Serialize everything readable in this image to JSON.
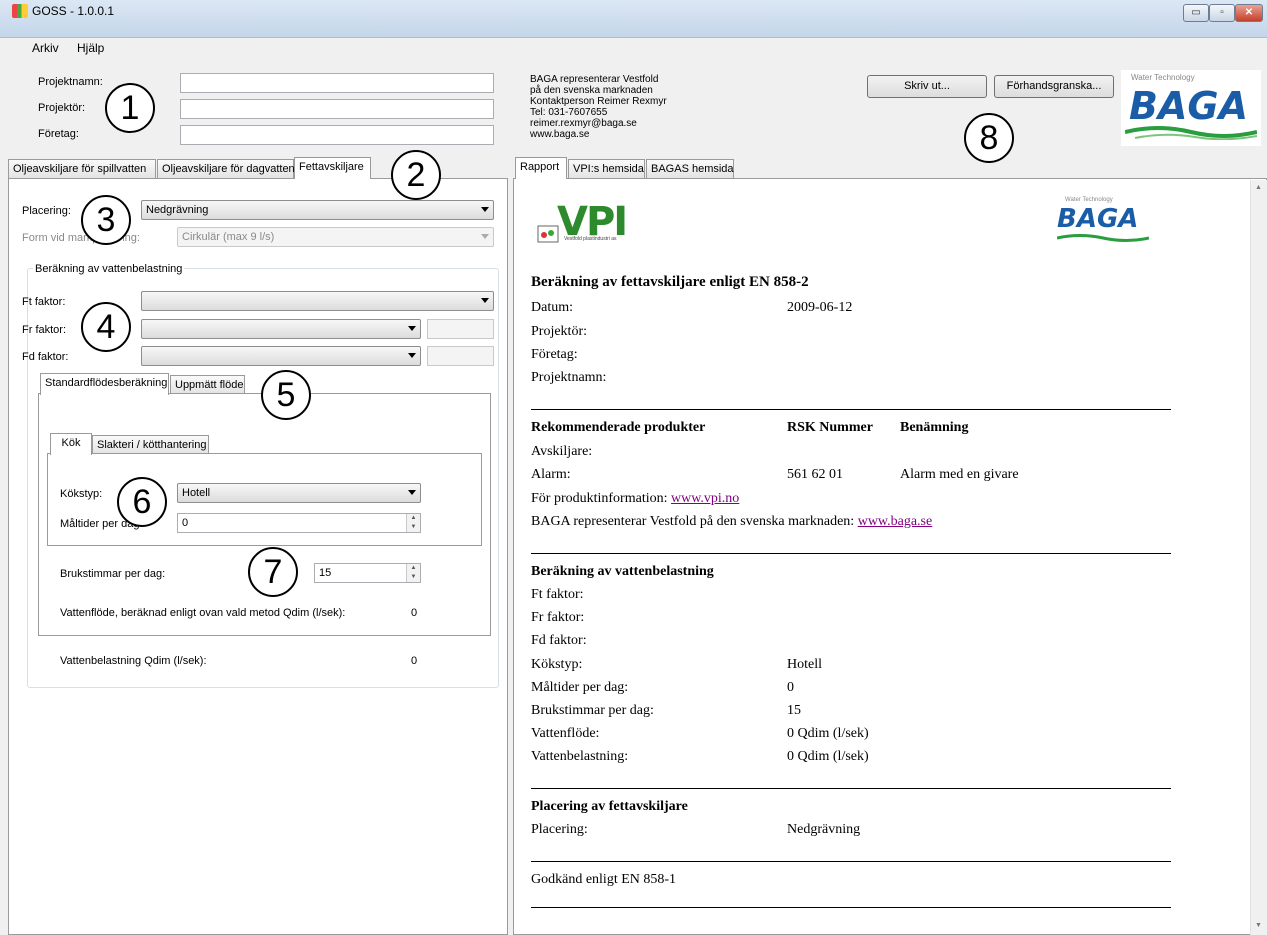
{
  "window": {
    "title": "GOSS - 1.0.0.1",
    "controls": {
      "minimize": "▭",
      "maximize": "▫",
      "close": "✕"
    }
  },
  "menu": [
    "Arkiv",
    "Hjälp"
  ],
  "project": {
    "name_label": "Projektnamn:",
    "designer_label": "Projektör:",
    "company_label": "Företag:",
    "name_value": "",
    "designer_value": "",
    "company_value": ""
  },
  "contact": {
    "lines": [
      "BAGA representerar Vestfold",
      "på den svenska marknaden",
      "Kontaktperson Reimer Rexmyr",
      "Tel: 031-7607655",
      "reimer.rexmyr@baga.se",
      "www.baga.se"
    ]
  },
  "buttons": {
    "print": "Skriv ut...",
    "preview": "Förhandsgranska..."
  },
  "logo": {
    "tagline": "Water Technology",
    "name": "BAGA",
    "vpi": "VPI",
    "vpi_sub": "Vestfold plastindustri as"
  },
  "left_tabs": [
    "Oljeavskiljare för spillvatten",
    "Oljeavskiljare för dagvatten",
    "Fettavskiljare"
  ],
  "form": {
    "placement_label": "Placering:",
    "placement_value": "Nedgrävning",
    "shape_label": "Form vid markplacering:",
    "shape_value": "Cirkulär (max 9 l/s)",
    "group_title": "Beräkning av vattenbelastning",
    "ft_label": "Ft faktor:",
    "fr_label": "Fr faktor:",
    "fd_label": "Fd faktor:",
    "sub_tabs": [
      "Standardflödesberäkning",
      "Uppmätt flöde"
    ],
    "inner_tabs": [
      "Kök",
      "Slakteri / kötthantering"
    ],
    "kitchen_label": "Kökstyp:",
    "kitchen_value": "Hotell",
    "meals_label": "Måltider per dag:",
    "meals_value": "0",
    "hours_label": "Brukstimmar per dag:",
    "hours_value": "15",
    "flow_label": "Vattenflöde, beräknad enligt ovan vald metod  Qdim (l/sek):",
    "flow_value": "0",
    "load_label": "Vattenbelastning Qdim (l/sek):",
    "load_value": "0"
  },
  "markers": [
    "1",
    "2",
    "3",
    "4",
    "5",
    "6",
    "7",
    "8"
  ],
  "right_tabs": [
    "Rapport",
    "VPI:s hemsida",
    "BAGAS hemsida"
  ],
  "report": {
    "title": "Beräkning av fettavskiljare enligt EN 858-2",
    "date_label": "Datum:",
    "date_value": "2009-06-12",
    "designer_label": "Projektör:",
    "company_label": "Företag:",
    "project_label": "Projektnamn:",
    "products_header": "Rekommenderade produkter",
    "rsk_header": "RSK Nummer",
    "name_header": "Benämning",
    "separator_label": "Avskiljare:",
    "alarm_label": "Alarm:",
    "alarm_rsk": "561 62 01",
    "alarm_name": "Alarm med en givare",
    "info_text": "För produktinformation:",
    "info_link": "www.vpi.no",
    "baga_text": "BAGA representerar Vestfold på den svenska marknaden:",
    "baga_link": "www.baga.se",
    "calc_header": "Beräkning av vattenbelastning",
    "ft_label": "Ft faktor:",
    "fr_label": "Fr faktor:",
    "fd_label": "Fd faktor:",
    "kitchen_label": "Kökstyp:",
    "kitchen_value": "Hotell",
    "meals_label": "Måltider per dag:",
    "meals_value": "0",
    "hours_label": "Brukstimmar per dag:",
    "hours_value": "15",
    "flow_label": "Vattenflöde:",
    "flow_value": "0 Qdim (l/sek)",
    "load_label": "Vattenbelastning:",
    "load_value": "0 Qdim (l/sek)",
    "placement_header": "Placering av fettavskiljare",
    "placement_label": "Placering:",
    "placement_value": "Nedgrävning",
    "approved": "Godkänd enligt EN 858-1"
  }
}
